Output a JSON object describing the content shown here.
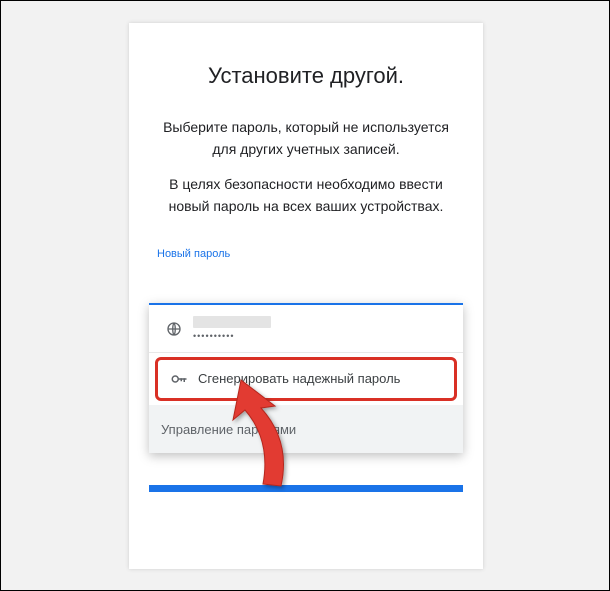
{
  "title": "Установите другой.",
  "description_line1": "Выберите пароль, который не используется для других учетных записей.",
  "description_line2": "В целях безопасности необходимо ввести новый пароль на всех ваших устройствах.",
  "field_label": "Новый пароль",
  "dropdown": {
    "saved_password_masked": "••••••••••",
    "generate_label": "Сгенерировать надежный пароль",
    "manage_label": "Управление паролями"
  },
  "colors": {
    "accent": "#1a73e8",
    "highlight_border": "#d93025"
  }
}
